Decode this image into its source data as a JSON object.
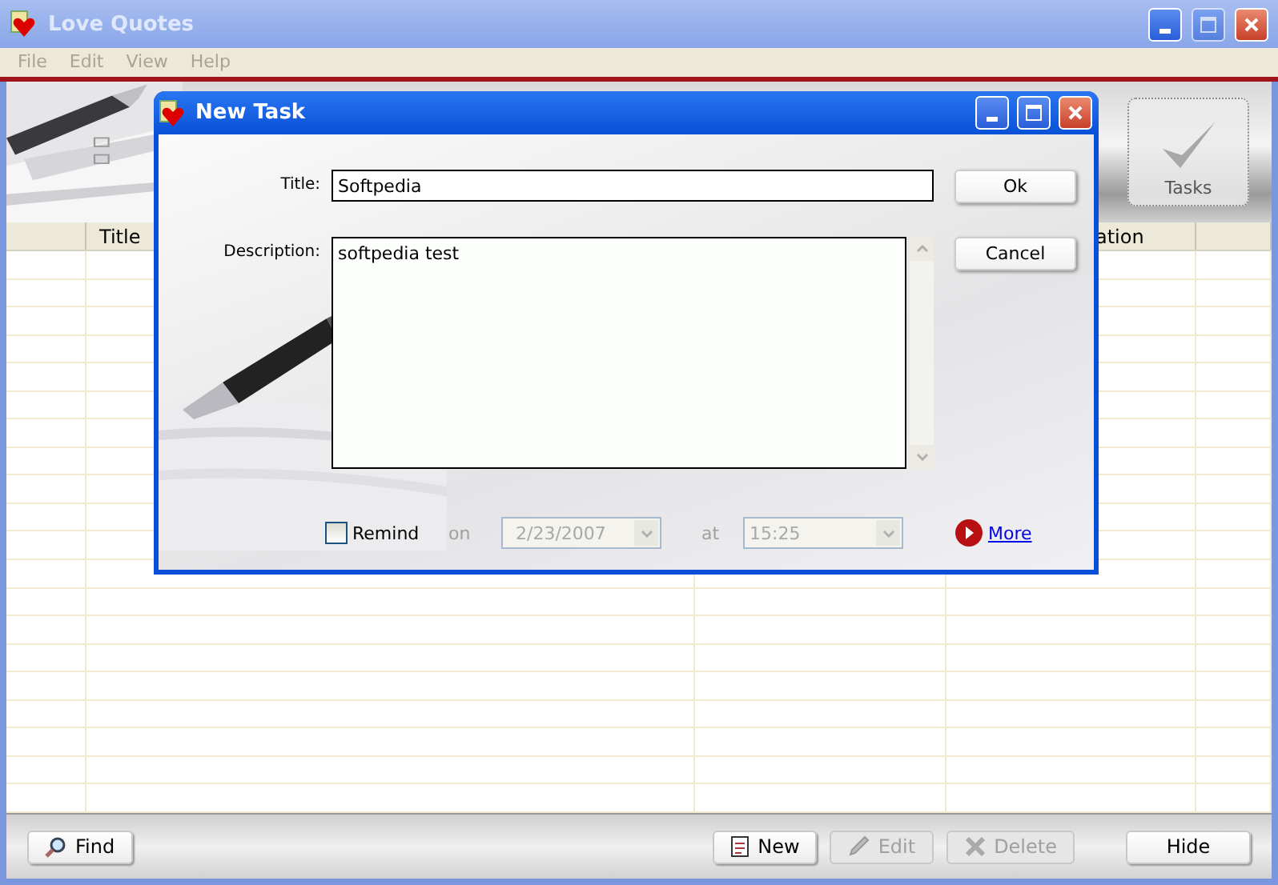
{
  "window": {
    "title": "Love Quotes",
    "active": false
  },
  "menu": [
    {
      "label": "File"
    },
    {
      "label": "Edit"
    },
    {
      "label": "View"
    },
    {
      "label": "Help"
    }
  ],
  "toolbar": {
    "tasks_button": "Tasks"
  },
  "table": {
    "columns": [
      {
        "label": "Title"
      },
      {
        "label": "ation"
      }
    ]
  },
  "footer_buttons": [
    {
      "label": "Find",
      "kind": "find",
      "disabled": false
    },
    {
      "label": "New",
      "kind": "new",
      "disabled": false
    },
    {
      "label": "Edit",
      "kind": "edit",
      "disabled": true
    },
    {
      "label": "Delete",
      "kind": "delete",
      "disabled": true
    },
    {
      "label": "Hide",
      "kind": "hide",
      "disabled": false
    }
  ],
  "dialog": {
    "title": "New Task",
    "title_label": "Title:",
    "title_value": "Softpedia",
    "description_label": "Description:",
    "description_value": "softpedia test",
    "ok": "Ok",
    "cancel": "Cancel",
    "remind": {
      "label": "Remind",
      "checked": false
    },
    "on_label": "on",
    "date": {
      "value": "2/23/2007",
      "disabled": true
    },
    "at_label": "at",
    "time": {
      "value": "15:25",
      "disabled": true
    },
    "more_link": "More"
  }
}
